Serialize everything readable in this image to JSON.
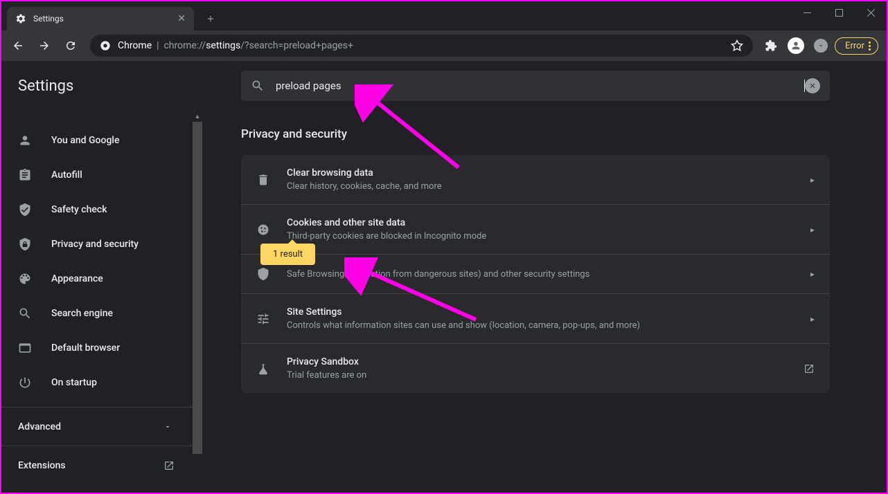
{
  "tab": {
    "title": "Settings"
  },
  "omnibox": {
    "label": "Chrome",
    "url_prefix": "chrome://",
    "url_bold": "settings",
    "url_suffix": "/?search=preload+pages+"
  },
  "error_button": "Error",
  "page_title": "Settings",
  "search": {
    "value": "preload pages"
  },
  "sidebar": {
    "items": [
      {
        "label": "You and Google",
        "icon": "person"
      },
      {
        "label": "Autofill",
        "icon": "clipboard"
      },
      {
        "label": "Safety check",
        "icon": "shield-check"
      },
      {
        "label": "Privacy and security",
        "icon": "shield-lock"
      },
      {
        "label": "Appearance",
        "icon": "palette"
      },
      {
        "label": "Search engine",
        "icon": "search"
      },
      {
        "label": "Default browser",
        "icon": "browser"
      },
      {
        "label": "On startup",
        "icon": "power"
      }
    ],
    "advanced": "Advanced",
    "extensions": "Extensions"
  },
  "section_title": "Privacy and security",
  "settings_list": [
    {
      "title": "Clear browsing data",
      "subtitle": "Clear history, cookies, cache, and more",
      "icon": "trash",
      "action": "arrow"
    },
    {
      "title": "Cookies and other site data",
      "subtitle": "Third-party cookies are blocked in Incognito mode",
      "icon": "cookie",
      "action": "arrow",
      "tooltip": "1 result"
    },
    {
      "title": "",
      "subtitle": "Safe Browsing (protection from dangerous sites) and other security settings",
      "icon": "security",
      "action": "arrow",
      "title_hidden": true
    },
    {
      "title": "Site Settings",
      "subtitle": "Controls what information sites can use and show (location, camera, pop-ups, and more)",
      "icon": "tune",
      "action": "arrow"
    },
    {
      "title": "Privacy Sandbox",
      "subtitle": "Trial features are on",
      "icon": "flask",
      "action": "launch"
    }
  ]
}
